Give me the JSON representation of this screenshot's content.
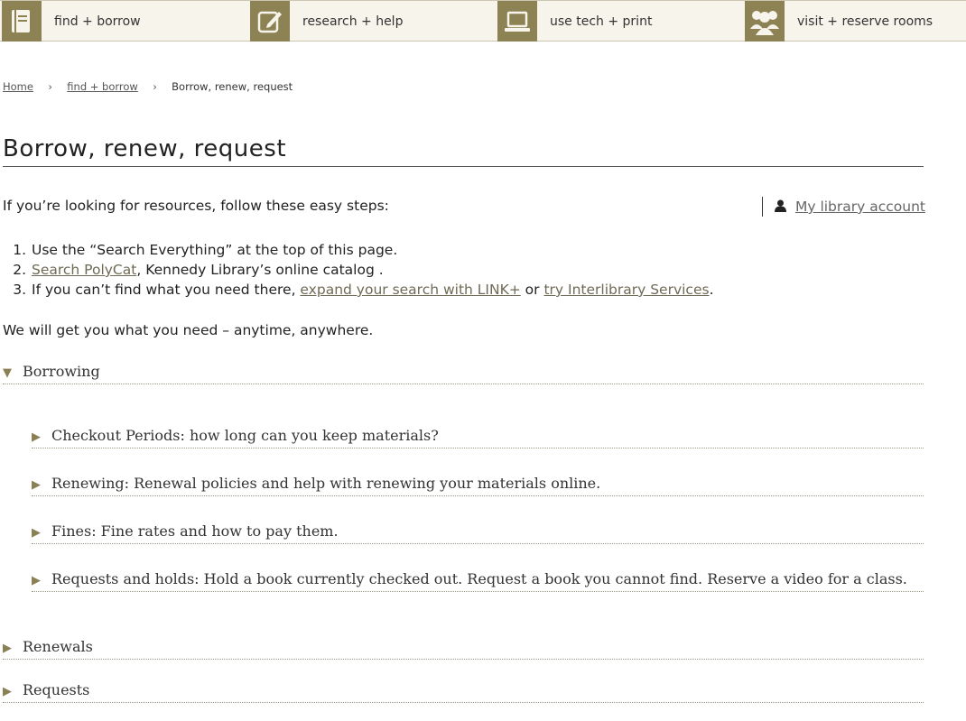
{
  "nav": {
    "items": [
      {
        "label": "find + borrow",
        "icon": "book-icon"
      },
      {
        "label": "research + help",
        "icon": "edit-icon"
      },
      {
        "label": "use tech + print",
        "icon": "laptop-icon"
      },
      {
        "label": "visit + reserve rooms",
        "icon": "group-icon"
      }
    ]
  },
  "breadcrumb": {
    "home": "Home",
    "section": "find + borrow",
    "current": "Borrow, renew, request",
    "separator": "›"
  },
  "page": {
    "title": "Borrow, renew, request",
    "intro": "If you’re looking for resources, follow these easy steps:",
    "account_link": "My library account",
    "steps": {
      "s1": {
        "num": "1.",
        "text": "Use the “Search Everything” at the top of this page."
      },
      "s2": {
        "num": "2.",
        "link": "Search PolyCat",
        "text": ", Kennedy Library’s online catalog ."
      },
      "s3": {
        "num": "3.",
        "pre": "If you can’t find what you need there, ",
        "link1": "expand your search with LINK+",
        "mid": " or ",
        "link2": "try Interlibrary Services",
        "post": "."
      }
    },
    "closing": "We will get you what you need – anytime, anywhere."
  },
  "accordion": {
    "borrowing": {
      "label": "Borrowing",
      "arrow": "▼"
    },
    "sub": {
      "checkout": {
        "label": "Checkout Periods: how long can you keep materials?",
        "arrow": "▶"
      },
      "renewing": {
        "label": "Renewing: Renewal policies and help with renewing your materials online.",
        "arrow": "▶"
      },
      "fines": {
        "label": "Fines: Fine rates and how to pay them.",
        "arrow": "▶"
      },
      "requests": {
        "label": "Requests and holds: Hold a book currently checked out. Request a book you cannot find. Reserve a video for a class.",
        "arrow": "▶"
      }
    },
    "renewals": {
      "label": "Renewals",
      "arrow": "▶"
    },
    "requests": {
      "label": "Requests",
      "arrow": "▶"
    }
  },
  "colors": {
    "accent": "#8d8254",
    "nav_bg": "#f7f4ec",
    "link": "#6e6a55"
  }
}
